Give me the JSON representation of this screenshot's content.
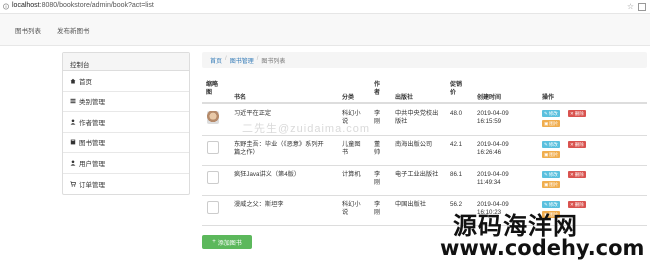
{
  "browser": {
    "url_host": "localhost",
    "url_rest": ":8080/bookstore/admin/book?act=list"
  },
  "topnav": {
    "links": [
      "图书列表",
      "发布新图书"
    ]
  },
  "sidebar": {
    "title": "控制台",
    "items": [
      {
        "label": "首页",
        "icon": "home-icon"
      },
      {
        "label": "类别管理",
        "icon": "list-icon"
      },
      {
        "label": "作者管理",
        "icon": "user-icon"
      },
      {
        "label": "图书管理",
        "icon": "book-icon"
      },
      {
        "label": "用户管理",
        "icon": "user-icon"
      },
      {
        "label": "订单管理",
        "icon": "cart-icon"
      }
    ]
  },
  "breadcrumb": {
    "home": "首页",
    "section": "图书管理",
    "current": "图书列表"
  },
  "table": {
    "headers": {
      "thumb": [
        "缩略",
        "图"
      ],
      "name": "书名",
      "category": "分类",
      "author": [
        "作",
        "者"
      ],
      "publisher": "出版社",
      "price": [
        "促销",
        "价"
      ],
      "created": "创建时间",
      "ops": "操作"
    },
    "rows": [
      {
        "name_lines": [
          "习近平在正定"
        ],
        "category_lines": [
          "科幻小",
          "说"
        ],
        "author_lines": [
          "李",
          "刚"
        ],
        "publisher_lines": [
          "中共中央党校出",
          "版社"
        ],
        "price": "48.0",
        "created_lines": [
          "2019-04-09",
          "16:15:59"
        ],
        "thumb": "image"
      },
      {
        "name_lines": [
          "东野圭吾：毕业（《恶意》系列开",
          "篇之作）"
        ],
        "category_lines": [
          "儿童图",
          "书"
        ],
        "author_lines": [
          "董",
          "帅"
        ],
        "publisher_lines": [
          "南海出版公司"
        ],
        "price": "42.1",
        "created_lines": [
          "2019-04-09",
          "16:26:46"
        ],
        "thumb": "broken"
      },
      {
        "name_lines": [
          "疯狂Java讲义（第4版）"
        ],
        "category_lines": [
          "计算机"
        ],
        "author_lines": [
          "李",
          "刚"
        ],
        "publisher_lines": [
          "电子工业出版社"
        ],
        "price": "86.1",
        "created_lines": [
          "2019-04-09",
          "11:49:34"
        ],
        "thumb": "broken"
      },
      {
        "name_lines": [
          "漫威之父：斯坦李"
        ],
        "category_lines": [
          "科幻小",
          "说"
        ],
        "author_lines": [
          "李",
          "刚"
        ],
        "publisher_lines": [
          "中国出版社"
        ],
        "price": "56.2",
        "created_lines": [
          "2019-04-09",
          "16:10:23"
        ],
        "thumb": "broken"
      }
    ],
    "buttons": {
      "edit": "修改",
      "delete": "删除",
      "picture": "图片"
    }
  },
  "add_button": "添加图书",
  "watermarks": {
    "middle": "二先生@zuidaima.com",
    "big": "源码海洋网",
    "url": "www.codehy.com"
  },
  "colors": {
    "link": "#337ab7",
    "edit": "#5bc0de",
    "delete": "#d9534f",
    "picture": "#f0ad4e",
    "add": "#5cb85c"
  }
}
